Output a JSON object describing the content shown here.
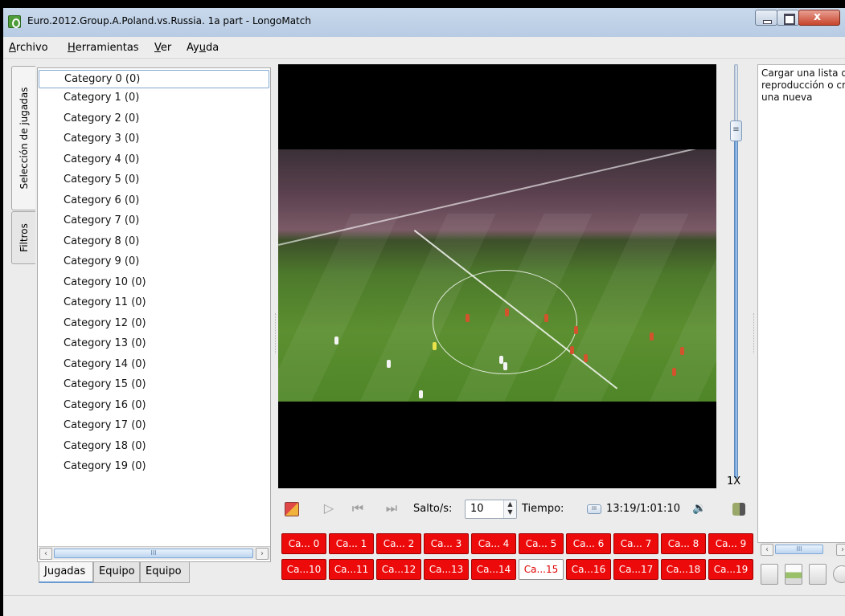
{
  "window": {
    "title": "Euro.2012.Group.A.Poland.vs.Russia. 1a part - LongoMatch",
    "icon": "longomatch-app-icon",
    "controls": [
      "minimize-icon",
      "maximize-icon",
      "close-icon"
    ]
  },
  "menubar": {
    "items": [
      {
        "label": "Archivo",
        "mnemonic": "A"
      },
      {
        "label": "Herramientas",
        "mnemonic": "H"
      },
      {
        "label": "Ver",
        "mnemonic": "V"
      },
      {
        "label": "Ayuda",
        "mnemonic": "u"
      }
    ]
  },
  "left_panel": {
    "vertical_tabs": [
      "Selección de jugadas",
      "Filtros"
    ],
    "categories": [
      "Category 0 (0)",
      "Category 1 (0)",
      "Category 2 (0)",
      "Category 3 (0)",
      "Category 4 (0)",
      "Category 5 (0)",
      "Category 6 (0)",
      "Category 7 (0)",
      "Category 8 (0)",
      "Category 9 (0)",
      "Category 10 (0)",
      "Category 11 (0)",
      "Category 12 (0)",
      "Category 13 (0)",
      "Category 14 (0)",
      "Category 15 (0)",
      "Category 16 (0)",
      "Category 17 (0)",
      "Category 18 (0)",
      "Category 19 (0)"
    ],
    "selected_category_index": 0,
    "scrollbar_grip": "III",
    "bottom_tabs": [
      {
        "label": "Jugadas",
        "active": true
      },
      {
        "label": "Equipo",
        "active": false
      },
      {
        "label": "Equipo",
        "active": false
      }
    ]
  },
  "player": {
    "speed_label": "1X",
    "speed_thumb_grip": "≡",
    "jump_label": "Salto/s:",
    "jump_value": "10",
    "time_label": "Tiempo:",
    "time_slider_grip": "III",
    "time_value": "13:19/1:01:10",
    "icons": [
      "draw-tool-icon",
      "play-icon",
      "previous-icon",
      "next-icon",
      "volume-icon",
      "detach-icon"
    ]
  },
  "category_buttons": {
    "row1": [
      "Ca... 0",
      "Ca... 1",
      "Ca... 2",
      "Ca... 3",
      "Ca... 4",
      "Ca... 5",
      "Ca... 6",
      "Ca... 7",
      "Ca... 8",
      "Ca... 9"
    ],
    "row2": [
      "Ca...10",
      "Ca...11",
      "Ca...12",
      "Ca...13",
      "Ca...14",
      "Ca...15",
      "Ca...16",
      "Ca...17",
      "Ca...18",
      "Ca...19"
    ],
    "selected": "Ca...15",
    "color": "#ec0a0a"
  },
  "right_panel": {
    "playlist_hint": "Cargar una lista de reproducción o crear una nueva",
    "scrollbar_grip": "III",
    "tools": [
      "new-playlist-icon",
      "open-playlist-icon",
      "save-playlist-icon",
      "record-icon"
    ]
  }
}
